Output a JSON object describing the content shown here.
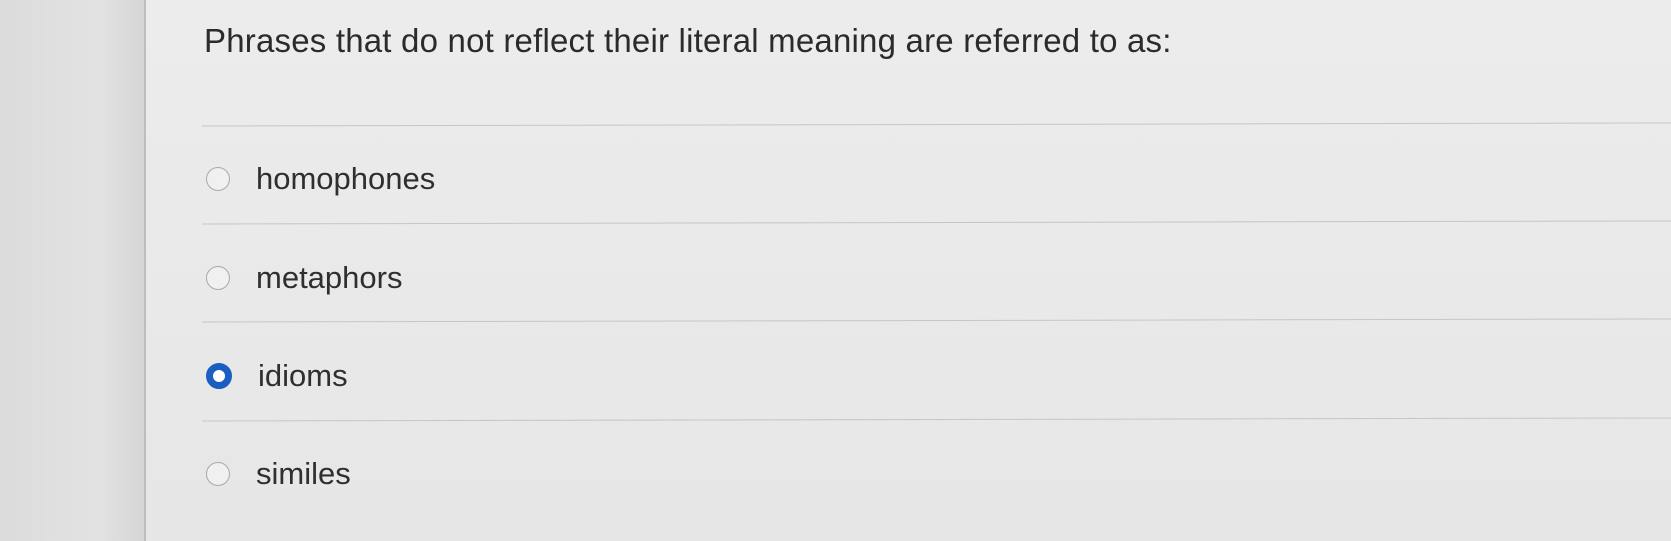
{
  "question": {
    "text": "Phrases that do not reflect their literal meaning are referred to as:"
  },
  "options": [
    {
      "label": "homophones",
      "selected": false
    },
    {
      "label": "metaphors",
      "selected": false
    },
    {
      "label": "idioms",
      "selected": true
    },
    {
      "label": "similes",
      "selected": false
    }
  ],
  "colors": {
    "selected_radio": "#1a5fc0",
    "background": "#e9e9e9"
  }
}
